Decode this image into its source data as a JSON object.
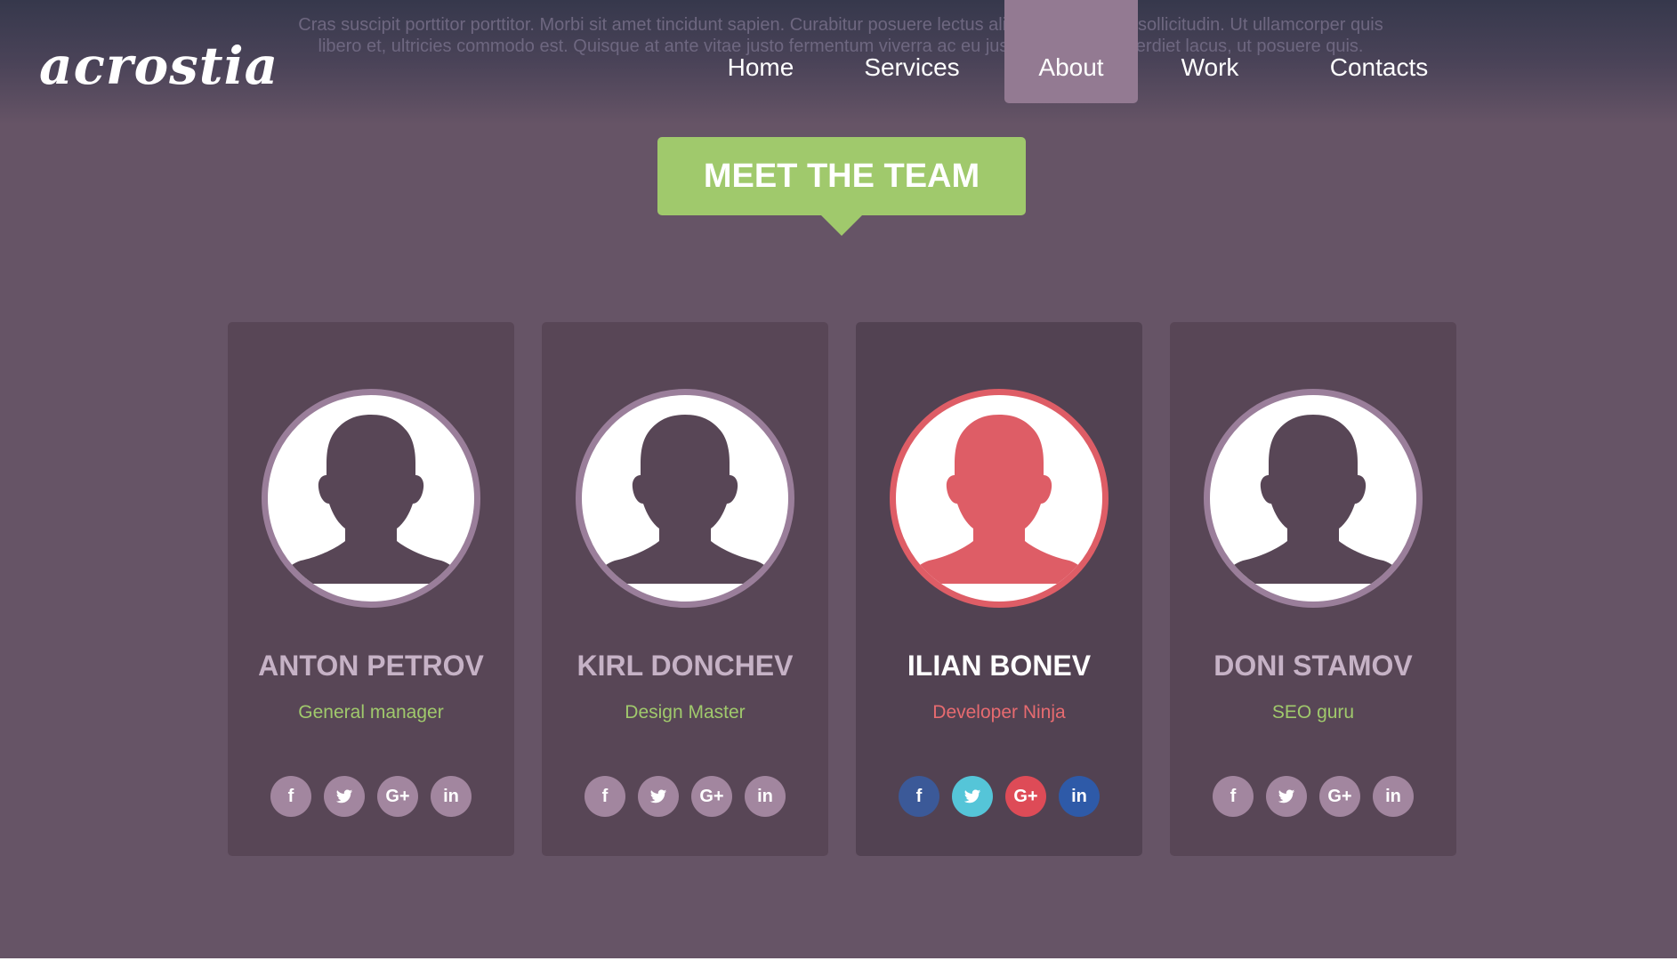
{
  "header": {
    "logo": "acrostia",
    "lorem_line1": "Cras suscipit porttitor porttitor. Morbi sit amet tincidunt sapien. Curabitur posuere lectus aliquet erat rutrum sollicitudin. Ut ullamcorper quis",
    "lorem_line2": "libero et, ultricies commodo est. Quisque at ante vitae justo fermentum viverra ac eu justo. Ut luctus imperdiet lacus, ut posuere quis."
  },
  "nav": [
    {
      "label": "Home"
    },
    {
      "label": "Services"
    },
    {
      "label": "About",
      "active": true
    },
    {
      "label": "Work"
    },
    {
      "label": "Contacts"
    }
  ],
  "section_title": "MEET THE TEAM",
  "colors": {
    "background": "#665466",
    "card": "#584656",
    "accent_green": "#a0c96c",
    "accent_red": "#de5d66",
    "facebook": "#3b5998",
    "twitter": "#55c5d8",
    "googleplus": "#de4b57",
    "linkedin": "#2e5aa8"
  },
  "social_icons": [
    "facebook-icon",
    "twitter-icon",
    "google-plus-icon",
    "linkedin-icon"
  ],
  "social_labels": {
    "facebook": "f",
    "googleplus": "G+",
    "linkedin": "in"
  },
  "team": [
    {
      "name": "ANTON PETROV",
      "role": "General manager"
    },
    {
      "name": "KIRL DONCHEV",
      "role": "Design Master"
    },
    {
      "name": "ILIAN BONEV",
      "role": "Developer Ninja",
      "featured": true
    },
    {
      "name": "DONI STAMOV",
      "role": "SEO guru"
    }
  ]
}
